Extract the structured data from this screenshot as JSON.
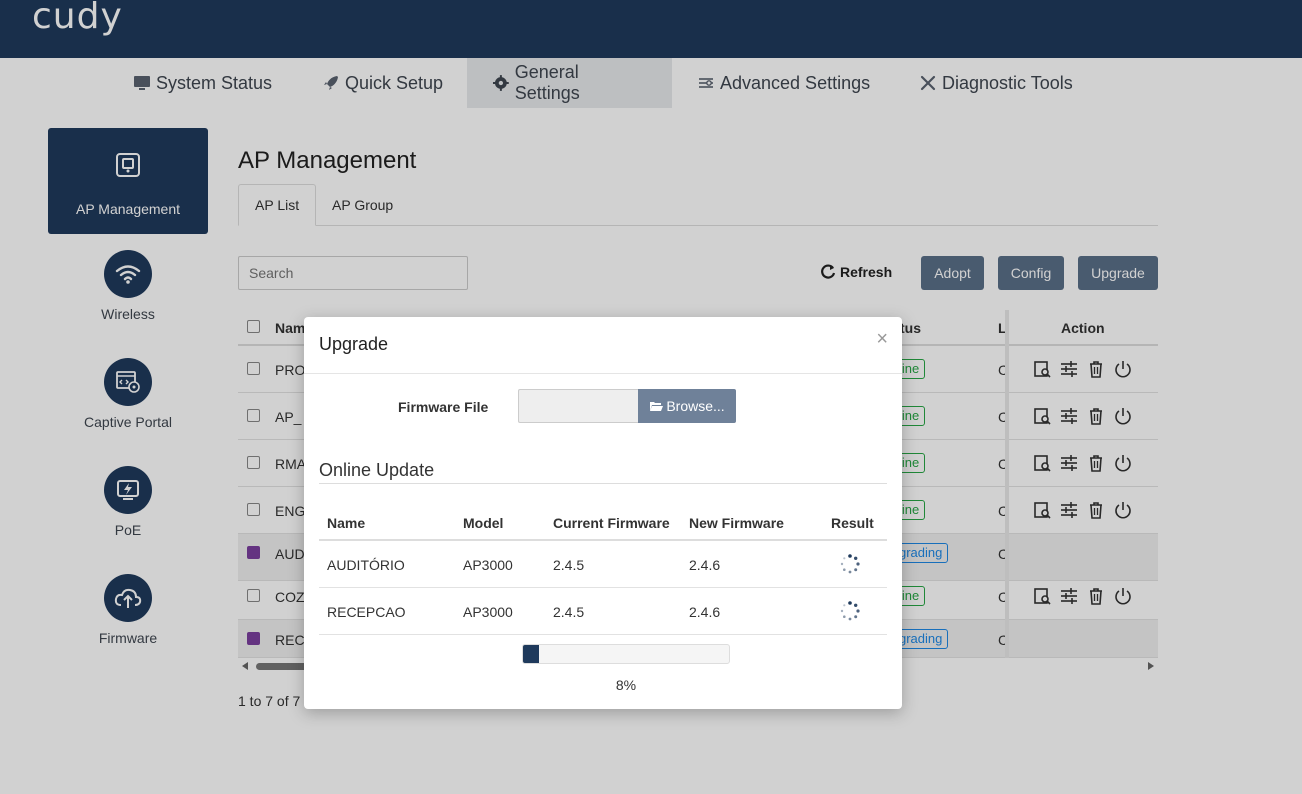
{
  "header": {
    "logo": "cudy",
    "brand_color": "#1f3a5c"
  },
  "nav": {
    "items": [
      {
        "label": "System Status",
        "icon": "monitor-icon"
      },
      {
        "label": "Quick Setup",
        "icon": "rocket-icon"
      },
      {
        "label": "General Settings",
        "icon": "gear-icon",
        "active": true
      },
      {
        "label": "Advanced Settings",
        "icon": "sliders-icon"
      },
      {
        "label": "Diagnostic Tools",
        "icon": "tools-icon"
      }
    ]
  },
  "sidebar": {
    "items": [
      {
        "label": "AP Management",
        "icon": "ap-icon",
        "active": true
      },
      {
        "label": "Wireless",
        "icon": "wifi-icon"
      },
      {
        "label": "Captive Portal",
        "icon": "captive-portal-icon"
      },
      {
        "label": "PoE",
        "icon": "poe-icon"
      },
      {
        "label": "Firmware",
        "icon": "cloud-upload-icon"
      }
    ]
  },
  "main": {
    "title": "AP Management",
    "tabs": [
      {
        "label": "AP List",
        "active": true
      },
      {
        "label": "AP Group"
      }
    ],
    "search": {
      "placeholder": "Search"
    },
    "toolbar": {
      "refresh": "Refresh",
      "adopt": "Adopt",
      "config": "Config",
      "upgrade": "Upgrade"
    },
    "table": {
      "headers": {
        "name": "Nam",
        "status": "tus",
        "loc": "L",
        "action": "Action"
      },
      "rows": [
        {
          "name": "PRO",
          "status": "line",
          "loc": "C",
          "checked": false,
          "actions": true
        },
        {
          "name": "AP_",
          "status": "line",
          "loc": "C",
          "checked": false,
          "actions": true
        },
        {
          "name": "RMA",
          "status": "line",
          "loc": "C",
          "checked": false,
          "actions": true
        },
        {
          "name": "ENG",
          "status": "line",
          "loc": "C",
          "checked": false,
          "actions": true
        },
        {
          "name": "AUD",
          "status": "grading",
          "loc": "C",
          "checked": true,
          "actions": false
        },
        {
          "name": "COZ",
          "status": "line",
          "loc": "C",
          "checked": false,
          "actions": true
        },
        {
          "name": "REC",
          "status": "grading",
          "loc": "C",
          "checked": true,
          "actions": false
        }
      ]
    },
    "pagination": "1 to 7 of 7"
  },
  "modal": {
    "title": "Upgrade",
    "close": "×",
    "firmware_label": "Firmware File",
    "browse_label": "Browse...",
    "online_update_title": "Online Update",
    "table_headers": {
      "name": "Name",
      "model": "Model",
      "current": "Current Firmware",
      "new": "New Firmware",
      "result": "Result"
    },
    "rows": [
      {
        "name": "AUDITÓRIO",
        "model": "AP3000",
        "current": "2.4.5",
        "new": "2.4.6"
      },
      {
        "name": "RECEPCAO",
        "model": "AP3000",
        "current": "2.4.5",
        "new": "2.4.6"
      }
    ],
    "progress_percent": 8,
    "progress_text": "8%"
  }
}
